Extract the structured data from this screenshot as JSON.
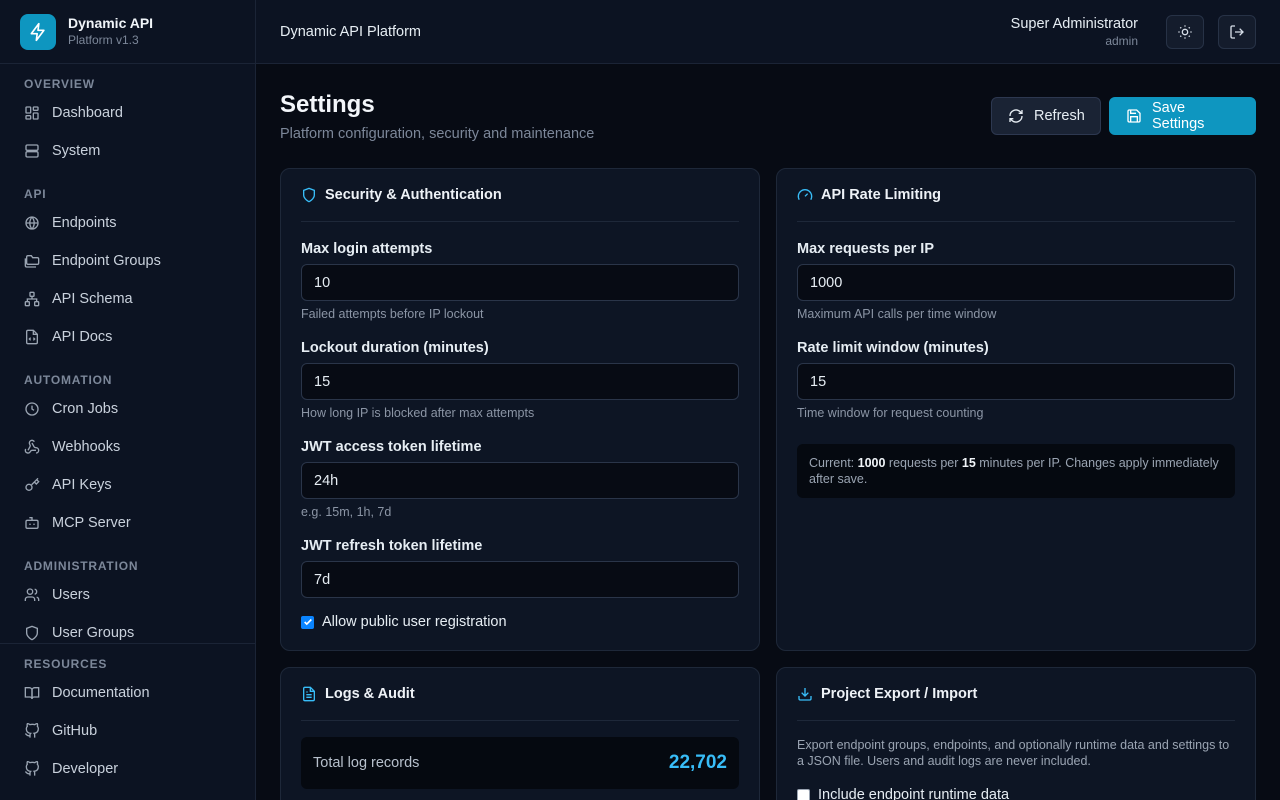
{
  "brand": {
    "name": "Dynamic API",
    "version": "Platform v1.3"
  },
  "topbar": {
    "title": "Dynamic API Platform",
    "user_name": "Super Administrator",
    "user_role": "admin"
  },
  "sidebar": {
    "sections": [
      {
        "title": "OVERVIEW",
        "items": [
          {
            "label": "Dashboard",
            "icon": "dashboard-icon"
          },
          {
            "label": "System",
            "icon": "server-icon"
          }
        ]
      },
      {
        "title": "API",
        "items": [
          {
            "label": "Endpoints",
            "icon": "globe-icon"
          },
          {
            "label": "Endpoint Groups",
            "icon": "folders-icon"
          },
          {
            "label": "API Schema",
            "icon": "network-icon"
          },
          {
            "label": "API Docs",
            "icon": "file-code-icon"
          }
        ]
      },
      {
        "title": "AUTOMATION",
        "items": [
          {
            "label": "Cron Jobs",
            "icon": "clock-icon"
          },
          {
            "label": "Webhooks",
            "icon": "webhook-icon"
          },
          {
            "label": "API Keys",
            "icon": "key-icon"
          },
          {
            "label": "MCP Server",
            "icon": "bot-icon"
          }
        ]
      },
      {
        "title": "ADMINISTRATION",
        "items": [
          {
            "label": "Users",
            "icon": "users-icon"
          },
          {
            "label": "User Groups",
            "icon": "shield-icon"
          }
        ]
      }
    ],
    "resources": {
      "title": "RESOURCES",
      "items": [
        {
          "label": "Documentation",
          "icon": "book-icon"
        },
        {
          "label": "GitHub",
          "icon": "github-icon"
        },
        {
          "label": "Developer",
          "icon": "github-icon"
        }
      ]
    }
  },
  "page": {
    "title": "Settings",
    "subtitle": "Platform configuration, security and maintenance",
    "refresh_label": "Refresh",
    "save_label": "Save Settings"
  },
  "security": {
    "title": "Security & Authentication",
    "fields": [
      {
        "label": "Max login attempts",
        "value": "10",
        "help": "Failed attempts before IP lockout"
      },
      {
        "label": "Lockout duration (minutes)",
        "value": "15",
        "help": "How long IP is blocked after max attempts"
      },
      {
        "label": "JWT access token lifetime",
        "value": "24h",
        "help": "e.g. 15m, 1h, 7d"
      },
      {
        "label": "JWT refresh token lifetime",
        "value": "7d",
        "help": ""
      }
    ],
    "registration_label": "Allow public user registration",
    "registration_checked": true
  },
  "rate": {
    "title": "API Rate Limiting",
    "fields": [
      {
        "label": "Max requests per IP",
        "value": "1000",
        "help": "Maximum API calls per time window"
      },
      {
        "label": "Rate limit window (minutes)",
        "value": "15",
        "help": "Time window for request counting"
      }
    ],
    "info_prefix": "Current: ",
    "info_requests": "1000",
    "info_mid": " requests per ",
    "info_minutes": "15",
    "info_suffix": " minutes per IP. Changes apply immediately after save."
  },
  "logs": {
    "title": "Logs & Audit",
    "total_label": "Total log records",
    "total_value": "22,702"
  },
  "export": {
    "title": "Project Export / Import",
    "description": "Export endpoint groups, endpoints, and optionally runtime data and settings to a JSON file. Users and audit logs are never included.",
    "runtime_label": "Include endpoint runtime data"
  },
  "colors": {
    "accent": "#0e96c0",
    "highlight": "#38bdf8",
    "background": "#070b14",
    "panel": "#0d1524"
  }
}
